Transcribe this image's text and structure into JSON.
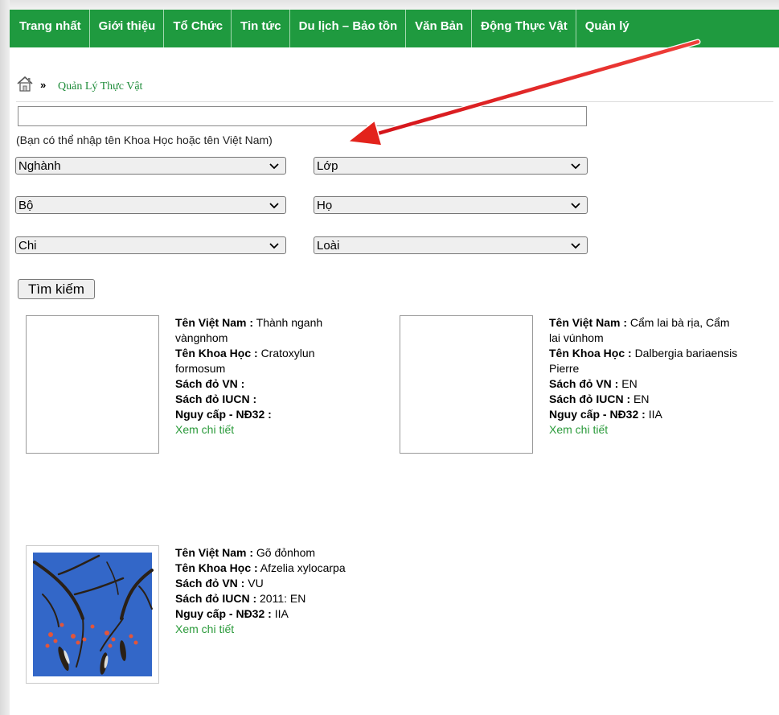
{
  "nav": {
    "items": [
      "Trang nhất",
      "Giới thiệu",
      "Tổ Chức",
      "Tin tức",
      "Du lịch – Bảo tồn",
      "Văn Bản",
      "Động Thực Vật",
      "Quản lý"
    ]
  },
  "breadcrumb": {
    "separator": "»",
    "current": "Quản Lý Thực Vật"
  },
  "search": {
    "value": "",
    "hint": "(Bạn có thể nhập tên Khoa Học hoặc tên Việt Nam)",
    "button_label": "Tìm kiếm"
  },
  "filters": {
    "nganh": "Nghành",
    "lop": "Lớp",
    "bo": "Bộ",
    "ho": "Họ",
    "chi": "Chi",
    "loai": "Loài"
  },
  "labels": {
    "ten_viet_nam": "Tên Việt Nam :",
    "ten_khoa_hoc": "Tên Khoa Học :",
    "sach_do_vn": "Sách đỏ VN :",
    "sach_do_iucn": "Sách đỏ IUCN :",
    "nguy_cap": "Nguy cấp - NĐ32 :",
    "xem_chi_tiet": "Xem chi tiết"
  },
  "results": [
    {
      "ten_viet_nam": "Thành nganh vàngnhom",
      "ten_khoa_hoc": "Cratoxylun formosum",
      "sach_do_vn": "",
      "sach_do_iucn": "",
      "nguy_cap": ""
    },
    {
      "ten_viet_nam": "Cẩm lai bà rịa, Cẩm lai vúnhom",
      "ten_khoa_hoc": "Dalbergia bariaensis Pierre",
      "sach_do_vn": "EN",
      "sach_do_iucn": "EN",
      "nguy_cap": "IIA"
    },
    {
      "ten_viet_nam": "Gõ đỏnhom",
      "ten_khoa_hoc": "Afzelia xylocarpa",
      "sach_do_vn": "VU",
      "sach_do_iucn": "2011: EN",
      "nguy_cap": "IIA"
    }
  ],
  "colors": {
    "nav_bg": "#1f9a3f",
    "link": "#2a9a3a",
    "arrow": "#e3231c"
  }
}
